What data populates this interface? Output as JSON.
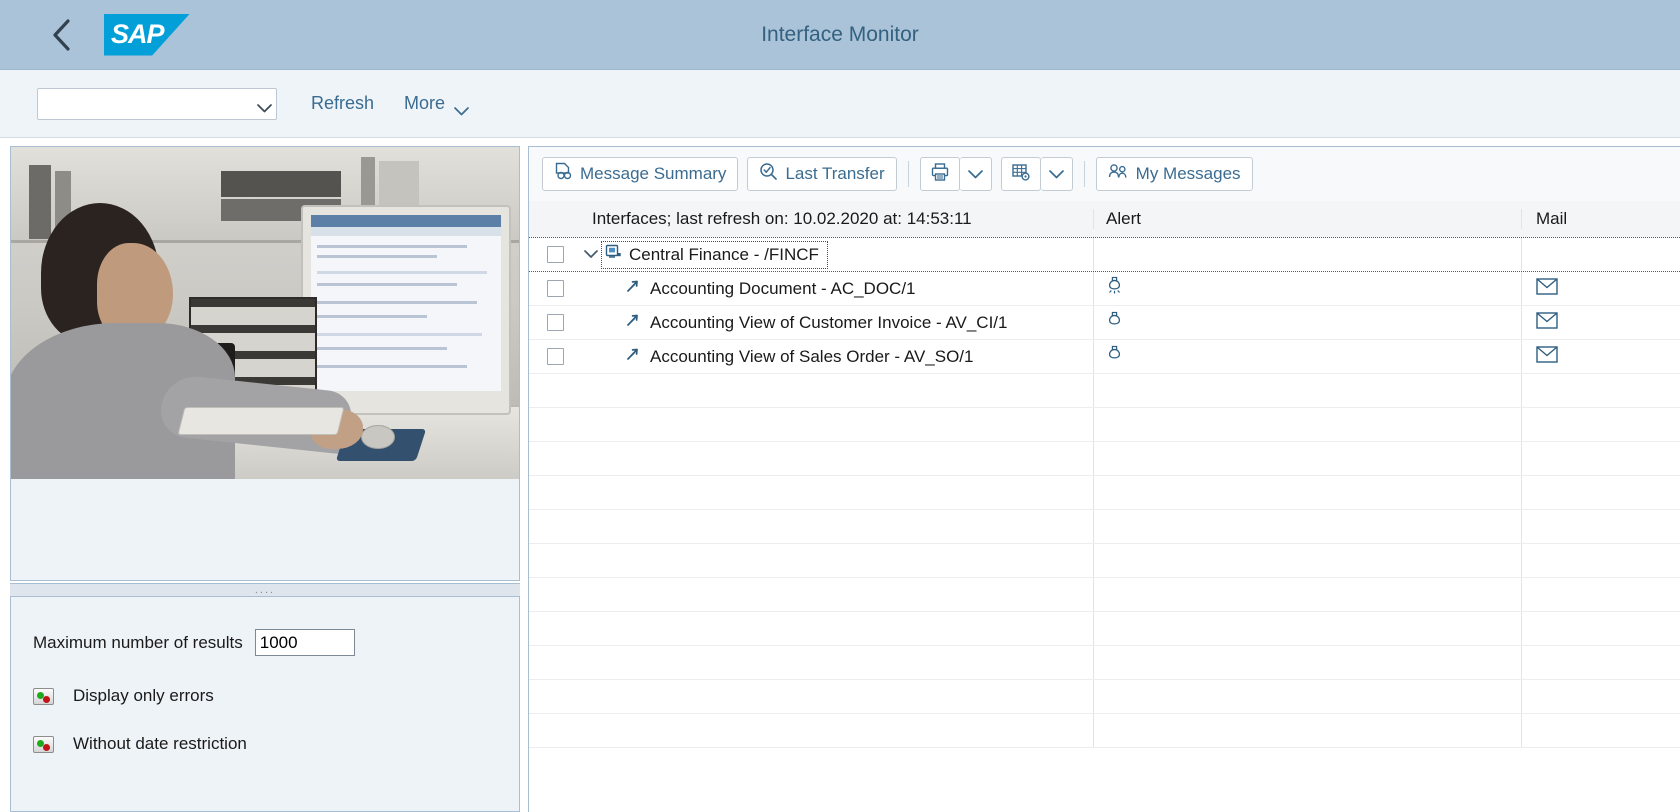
{
  "shell": {
    "back_icon": "back-chevron-icon",
    "logo_text": "SAP",
    "title": "Interface Monitor"
  },
  "toolbar": {
    "variant_value": "",
    "variant_placeholder": "",
    "refresh_label": "Refresh",
    "more_label": "More",
    "chevron_icon": "chevron-down-icon"
  },
  "left_panel": {
    "photo_alt": "office-worker-photo",
    "splitter_grip": "....",
    "filters": {
      "max_results_label": "Maximum number of results",
      "max_results_value": "1000",
      "actions": [
        {
          "label": "Display only errors",
          "icon": "status-toggle-icon"
        },
        {
          "label": "Without date restriction",
          "icon": "status-toggle-icon"
        }
      ]
    }
  },
  "table_toolbar": {
    "buttons": [
      {
        "id": "message-summary",
        "label": "Message Summary",
        "icon": "message-summary-icon"
      },
      {
        "id": "last-transfer",
        "label": "Last Transfer",
        "icon": "search-check-icon"
      },
      {
        "id": "print",
        "label": "",
        "icon": "printer-icon"
      },
      {
        "id": "print-menu",
        "label": "",
        "icon": "chevron-down-icon"
      },
      {
        "id": "table-settings",
        "label": "",
        "icon": "table-settings-icon"
      },
      {
        "id": "table-settings-menu",
        "label": "",
        "icon": "chevron-down-icon"
      },
      {
        "id": "my-messages",
        "label": "My Messages",
        "icon": "people-icon"
      }
    ]
  },
  "table": {
    "columns": {
      "name": "Interfaces; last refresh on: 10.02.2020 at: 14:53:11",
      "alert": "Alert",
      "mail": "Mail"
    },
    "rows": [
      {
        "type": "node",
        "expanded": true,
        "icon": "system-node-icon",
        "name": "Central Finance - /FINCF",
        "alert": "",
        "mail": ""
      },
      {
        "type": "leaf",
        "icon": "interface-arrow-icon",
        "name": "Accounting Document - AC_DOC/1",
        "alert": "lightbulb-alert-icon",
        "mail": "envelope-icon"
      },
      {
        "type": "leaf",
        "icon": "interface-arrow-icon",
        "name": "Accounting View of Customer Invoice - AV_CI/1",
        "alert": "lightbulb-alert-icon",
        "mail": "envelope-icon"
      },
      {
        "type": "leaf",
        "icon": "interface-arrow-icon",
        "name": "Accounting View of Sales Order - AV_SO/1",
        "alert": "lightbulb-alert-icon",
        "mail": "envelope-icon"
      }
    ],
    "empty_row_count": 11
  },
  "colors": {
    "shell_bg": "#abc3d9",
    "sap_blue": "#029fd9",
    "link_blue": "#3a6c91",
    "title_blue": "#33617f",
    "panel_bg": "#eef3f8"
  }
}
